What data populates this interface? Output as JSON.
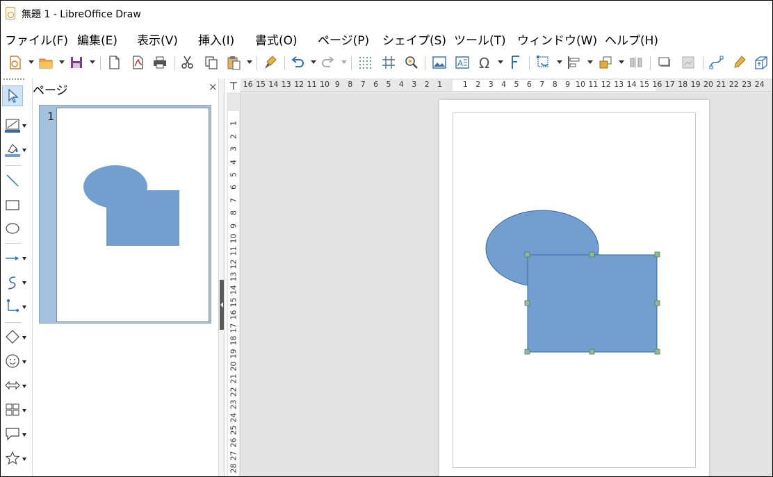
{
  "window": {
    "title": "無題 1 - LibreOffice Draw"
  },
  "menu": [
    "ファイル(F)",
    "編集(E)",
    "表示(V)",
    "挿入(I)",
    "書式(O)",
    "ページ(P)",
    "シェイプ(S)",
    "ツール(T)",
    "ウィンドウ(W)",
    "ヘルプ(H)"
  ],
  "toolbar": {
    "icons": [
      "new-icon",
      "open-icon",
      "save-icon",
      "export-icon",
      "export-pdf-icon",
      "print-icon",
      "cut-icon",
      "copy-icon",
      "paste-icon",
      "clone-formatting-icon",
      "undo-icon",
      "redo-icon",
      "grid-icon",
      "helplines-icon",
      "zoom-pan-icon",
      "image-icon",
      "textbox-icon",
      "special-character-icon",
      "fontwork-icon",
      "transformations-icon",
      "align-icon",
      "arrange-icon",
      "distribute-icon",
      "shadow-icon",
      "crop-icon",
      "points-icon",
      "glue-points-icon",
      "toggle-extrusion-icon"
    ]
  },
  "pages_pane": {
    "title": "ページ",
    "close_label": "×",
    "page_number": "1"
  },
  "ruler": {
    "horizontal_labels": [
      "16",
      "15",
      "14",
      "13",
      "12",
      "11",
      "10",
      "9",
      "8",
      "7",
      "6",
      "5",
      "4",
      "3",
      "2",
      "1",
      "",
      "1",
      "2",
      "3",
      "4",
      "5",
      "6",
      "7",
      "8",
      "9",
      "10",
      "11",
      "12",
      "13",
      "14",
      "15",
      "16",
      "17",
      "18",
      "19",
      "20",
      "21",
      "22",
      "23",
      "24"
    ],
    "vertical_labels": [
      "1",
      "2",
      "3",
      "4",
      "5",
      "6",
      "7",
      "8",
      "9",
      "10",
      "11",
      "12",
      "13",
      "14",
      "15",
      "16",
      "17",
      "18",
      "19",
      "20",
      "21",
      "22",
      "23",
      "24",
      "25",
      "26",
      "27",
      "28"
    ]
  },
  "colors": {
    "shape_fill": "#729fcf",
    "shape_stroke": "#3465a4",
    "handle_fill": "#8fbc8f",
    "handle_stroke": "#4a7a6a",
    "accent": "#cfe3f7"
  }
}
